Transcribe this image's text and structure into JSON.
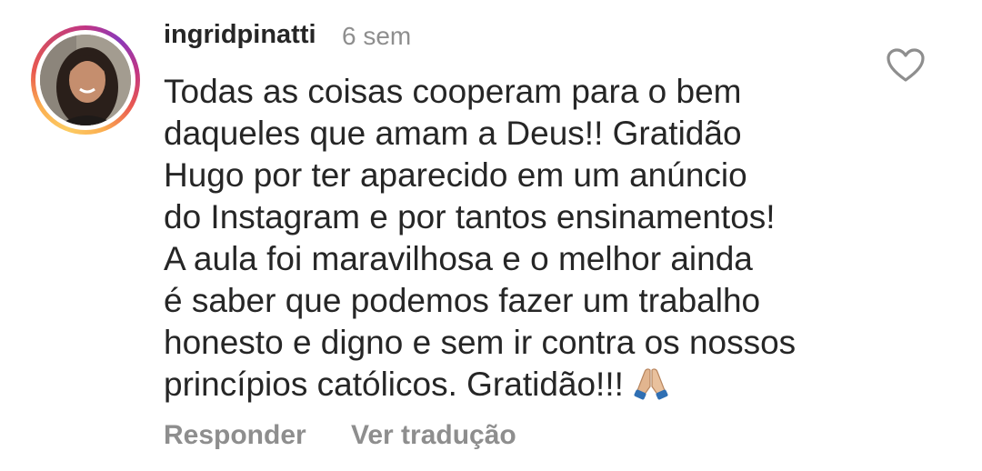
{
  "comment": {
    "username": "ingridpinatti",
    "time": "6 sem",
    "lines": [
      "Todas as coisas cooperam para o bem",
      "daqueles que amam a Deus!! Gratidão",
      "Hugo por ter aparecido em um anúncio",
      "do Instagram e por tantos ensinamentos!",
      "A aula foi maravilhosa e o melhor ainda",
      "é saber que podemos fazer um trabalho",
      "honesto e digno e sem ir contra os nossos",
      "princípios católicos. Gratidão!!!"
    ],
    "emoji": "folded-hands",
    "like_icon": "heart-outline-icon"
  },
  "actions": {
    "reply_label": "Responder",
    "translate_label": "Ver tradução"
  },
  "colors": {
    "primary_text": "#262626",
    "secondary_text": "#8e8e8e",
    "story_ring": "#c13584"
  }
}
